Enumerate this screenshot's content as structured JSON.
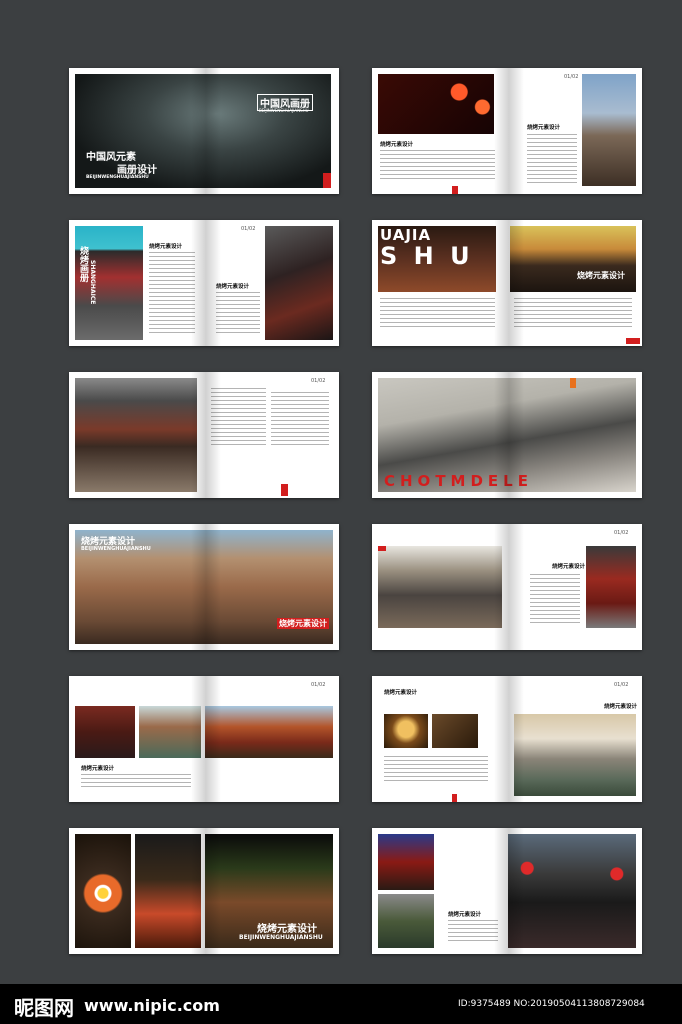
{
  "s1": {
    "title": "中国风画册",
    "subtitle": "BEIJINWENGHUAJIANSHU",
    "heading1": "中国风元素",
    "heading2": "画册设计",
    "heading_sub": "BEIJINWENGHUAJIANSHU"
  },
  "s2": {
    "page": "01/02",
    "title": "烧烤元素设计"
  },
  "s3": {
    "title": "烧烤元素设计",
    "vertical_title": "烧烤画册",
    "vertical_sub": "SHANGHAICE",
    "page": "01/02",
    "title2": "烧烤元素设计"
  },
  "s4": {
    "big1": "UAJIA",
    "big2": "S H U",
    "caption": "烧烤元素设计"
  },
  "s5": {
    "page": "01/02"
  },
  "s6": {
    "big": "CHOTMDELE"
  },
  "s7": {
    "title": "烧烤元素设计",
    "sub": "BEIJINWENGHUAJIANSHU",
    "caption": "烧烤元素设计"
  },
  "s8": {
    "page": "01/02",
    "title": "烧烤元素设计"
  },
  "s9": {
    "page": "01/02",
    "title": "烧烤元素设计"
  },
  "s10": {
    "title": "烧烤元素设计",
    "page": "01/02",
    "title2": "烧烤元素设计"
  },
  "s11": {
    "title": "烧烤元素设计",
    "sub": "BEIJINWENGHUAJIANSHU"
  },
  "s12": {
    "title": "烧烤元素设计"
  },
  "footer": {
    "logo": "昵图网",
    "url": "www.nipic.com",
    "id": "ID:9375489 NO:20190504113808729084"
  }
}
